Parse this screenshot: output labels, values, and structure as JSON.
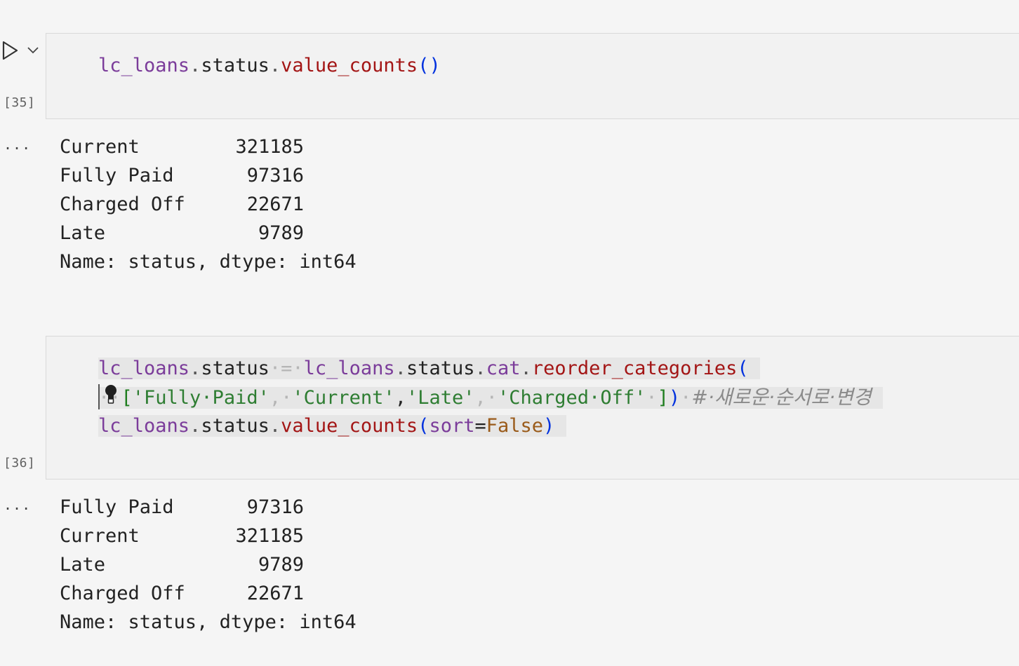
{
  "cells": [
    {
      "exec_count": "[35]",
      "code": {
        "line1": [
          "lc_loans",
          ".",
          "status",
          ".",
          "value_counts",
          "()"
        ]
      },
      "output": {
        "rows": [
          {
            "label": "Current",
            "value": "321185"
          },
          {
            "label": "Fully Paid",
            "value": "97316"
          },
          {
            "label": "Charged Off",
            "value": "22671"
          },
          {
            "label": "Late",
            "value": "9789"
          }
        ],
        "footer": "Name: status, dtype: int64"
      },
      "output_toggle": "..."
    },
    {
      "exec_count": "[36]",
      "code": {
        "line1": [
          "lc_loans",
          ".",
          "status",
          "·=·",
          "lc_loans",
          ".",
          "status",
          ".",
          "cat",
          ".",
          "reorder_categories",
          "("
        ],
        "line2": [
          "··",
          "[",
          "'Fully·Paid'",
          ",·",
          "'Current'",
          ",",
          "'Late'",
          ",·",
          "'Charged·Off'",
          "·",
          "]",
          ")",
          "·",
          "#·새로운·순서로·변경"
        ],
        "line3": [
          "lc_loans",
          ".",
          "status",
          ".",
          "value_counts",
          "(",
          "sort",
          "=",
          "False",
          ")"
        ]
      },
      "output": {
        "rows": [
          {
            "label": "Fully Paid",
            "value": "97316"
          },
          {
            "label": "Current",
            "value": "321185"
          },
          {
            "label": "Late",
            "value": "9789"
          },
          {
            "label": "Charged Off",
            "value": "22671"
          }
        ],
        "footer": "Name: status, dtype: int64"
      },
      "output_toggle": "..."
    }
  ],
  "icons": {
    "run": "run-cell-icon",
    "chevron": "chevron-down-icon",
    "lightbulb": "lightbulb-icon"
  }
}
